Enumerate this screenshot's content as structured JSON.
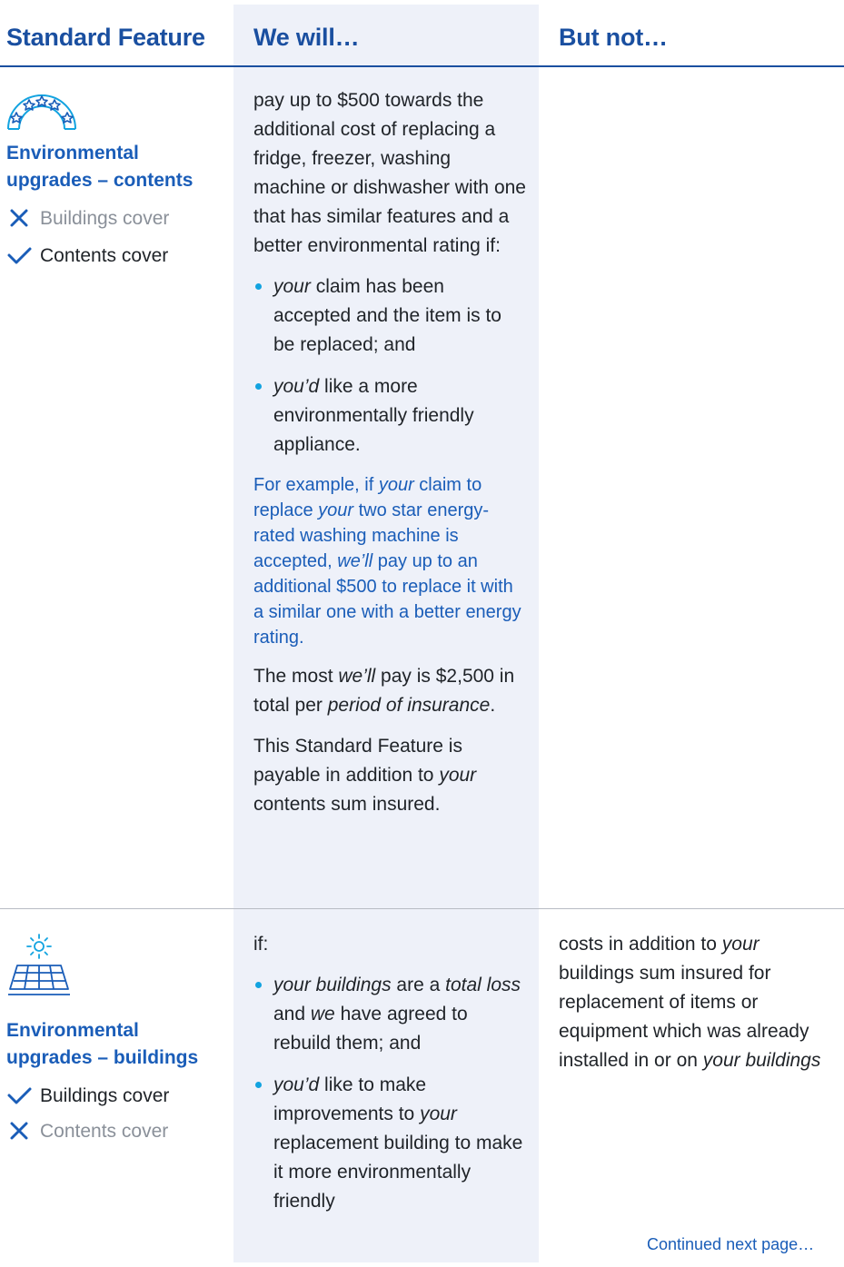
{
  "headers": {
    "feature": "Standard Feature",
    "will": "We will…",
    "not": "But not…"
  },
  "row1": {
    "title_line1": "Environmental",
    "title_line2": "upgrades – contents",
    "covers": [
      {
        "label": "Buildings cover",
        "included": false
      },
      {
        "label": "Contents cover",
        "included": true
      }
    ],
    "icon": "star-rating-rainbow-icon",
    "will": {
      "intro": "pay up to $500 towards the additional cost of replacing a fridge, freezer, washing machine or dishwasher with one that has similar features and a better environmental rating if:",
      "bullet1_em": "your",
      "bullet1_rest": " claim has been accepted and the item is to be replaced; and",
      "bullet2_em": "you’d",
      "bullet2_rest": " like a more environmentally friendly appliance.",
      "ex_a": "For example, if ",
      "ex_b": "your",
      "ex_c": " claim to replace ",
      "ex_d": "your",
      "ex_e": " two star energy-rated washing machine is accepted, ",
      "ex_f": "we’ll",
      "ex_g": " pay up to an additional $500 to replace it with a similar one with a better energy rating.",
      "max_a": "The most ",
      "max_b": "we’ll",
      "max_c": " pay is $2,500 in total per ",
      "max_d": "period of insurance",
      "max_e": ".",
      "add_a": "This Standard Feature is payable in addition to ",
      "add_b": "your",
      "add_c": " contents sum insured."
    },
    "not": ""
  },
  "row2": {
    "title_line1": "Environmental",
    "title_line2": "upgrades – buildings",
    "covers": [
      {
        "label": "Buildings cover",
        "included": true
      },
      {
        "label": "Contents cover",
        "included": false
      }
    ],
    "icon": "solar-panel-icon",
    "will": {
      "intro": "if:",
      "b1_a": "your buildings",
      "b1_b": " are a ",
      "b1_c": "total loss",
      "b1_d": " and ",
      "b1_e": "we",
      "b1_f": " have agreed to rebuild them; and",
      "b2_a": "you’d",
      "b2_b": " like to make improvements to ",
      "b2_c": "your",
      "b2_d": " replacement building to make it more environmentally friendly"
    },
    "not": {
      "a": "costs in addition to ",
      "b": "your",
      "c": " buildings sum insured for replacement of items or equipment which was already installed in or on ",
      "d": "your buildings"
    }
  },
  "footer": {
    "continued": "Continued next page…"
  },
  "colors": {
    "heading": "#1a4fa0",
    "accent": "#1a5db8",
    "bullet": "#12a3e0",
    "column_bg": "#eef1f9"
  }
}
